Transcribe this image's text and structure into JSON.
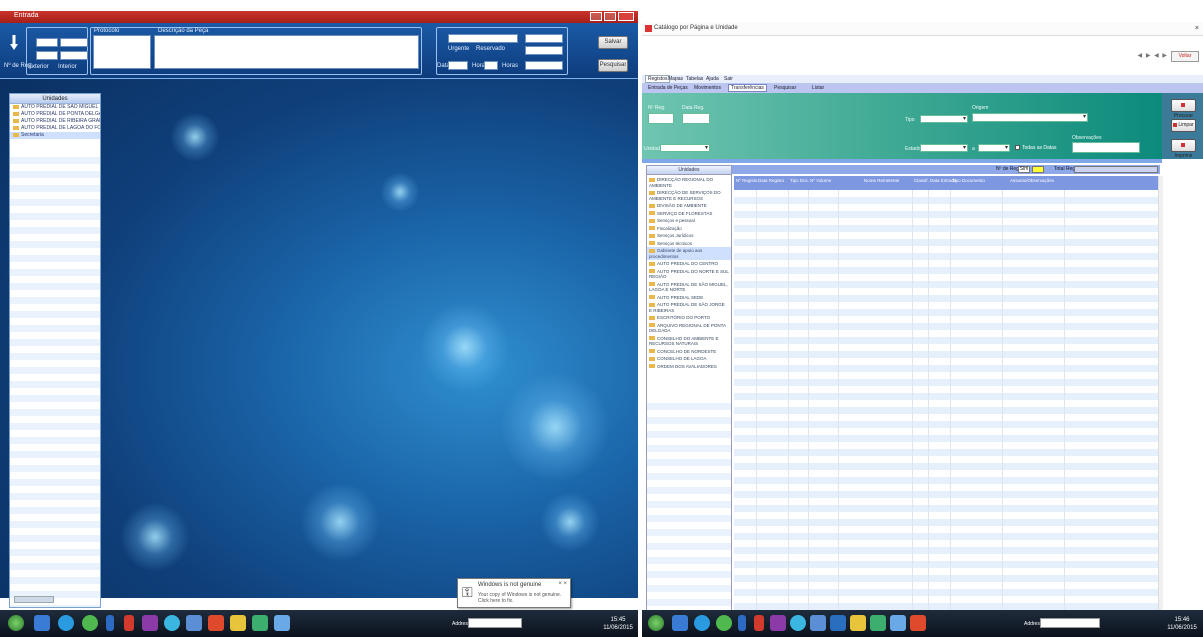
{
  "left_screen": {
    "title": "Entrada",
    "toolbar": {
      "number_label": "Nº de Reg.",
      "protocol_label": "Protocolo",
      "description_label": "Descrição da Peça",
      "date_label": "Data",
      "time_label": "Hora",
      "hour_label": "Horas",
      "save_label": "Salvar",
      "search_label": "Pesquisar",
      "checkbox_a": "Exterior",
      "checkbox_b": "Interior",
      "checkbox_c": "Urgente",
      "checkbox_d": "Reservado"
    },
    "tree": {
      "header": "Unidades",
      "items": [
        "AUTO PREDIAL DE SÃO MIGUEL",
        "AUTO PREDIAL DE PONTA DELGADA",
        "AUTO PREDIAL DE RIBEIRA GRANDE",
        "AUTO PREDIAL DE LAGOA DO FOGO",
        "Secretaria"
      ],
      "selected_index": 4
    },
    "notification": {
      "title": "Windows is not genuine",
      "body": "Your copy of Windows is not genuine. Click here to fix.",
      "close": "× ×"
    },
    "taskbar": {
      "search_label": "Address",
      "clock_time": "15:45",
      "clock_date": "11/06/2015"
    }
  },
  "right_screen": {
    "title": "Catálogo por Página e Unidade",
    "nav_arrows": "◀ ▶ ◀ ▶",
    "back_button": "Voltar",
    "menu": [
      "Registos",
      "Mapas",
      "Tabelas",
      "Ajuda",
      "Sair"
    ],
    "menu_active": 0,
    "submenu": [
      "Entrada de Peças",
      "Movimentos",
      "Transferências",
      "Pesquisar",
      "Listar"
    ],
    "submenu_active": 2,
    "filter": {
      "num_label": "Nº Reg.",
      "date_label": "Data Reg.",
      "type_label": "Tipo",
      "unit_label": "Unidade",
      "origin_label": "Origem",
      "state_label": "Estado",
      "to_label": "a",
      "check_label": "Todas as Datas",
      "obs_label": "Observações"
    },
    "side_buttons": [
      "Procurar",
      "Limpar",
      "Imprimir"
    ],
    "legend": {
      "label_a": "Nº de Reg.",
      "value_a": "Sim",
      "label_b": "Total Registos"
    },
    "tree": {
      "header": "Unidades",
      "items": [
        "DIRECÇÃO REGIONAL DO AMBIENTE",
        "DIRECÇÃO DE SERVIÇOS DO AMBIENTE E RECURSOS",
        "DIVISÃO DE AMBIENTE",
        "SERVIÇO DE FLORESTAS",
        "Serviços e pessoal",
        "Fiscalização",
        "Serviços Jurídicos",
        "Serviços técnicos",
        "Gabinete de apoio aos procedimentos",
        "AUTO PREDIAL DO CENTRO",
        "AUTO PREDIAL DO NORTE E SUL REGIÃO",
        "AUTO PREDIAL DE SÃO MIGUEL, LAGOA E NORTE",
        "AUTO PREDIAL SEDE",
        "AUTO PREDIAL DE SÃO JORGE E RIBEIRAS",
        "ESCRITÓRIO DO PORTO",
        "ARQUIVO REGIONAL DE PONTA DELGADA",
        "CONSELHO DO AMBIENTE E RECURSOS NATURAIS",
        "CONCELHO DE NORDESTE",
        "CONSELHO DE LAGOA",
        "ORDEM DOS AVALIADORES"
      ],
      "selected_index": 8
    },
    "grid": {
      "columns": [
        "Nº Registo",
        "Data Registo",
        "Tipo Doc.",
        "Nº Volume",
        "Nome Remetente",
        "Classif.",
        "Data Entrada",
        "Tipo Documento",
        "Assunto/Observações"
      ]
    },
    "taskbar": {
      "search_label": "Address",
      "clock_time": "15:46",
      "clock_date": "11/06/2015"
    }
  },
  "colors": {
    "accent_red": "#c9342b",
    "desktop_blue": "#1a64a8",
    "filter_teal": "#3da893",
    "header_periwinkle": "#7d97e1",
    "highlight_yellow": "#ffff33"
  }
}
